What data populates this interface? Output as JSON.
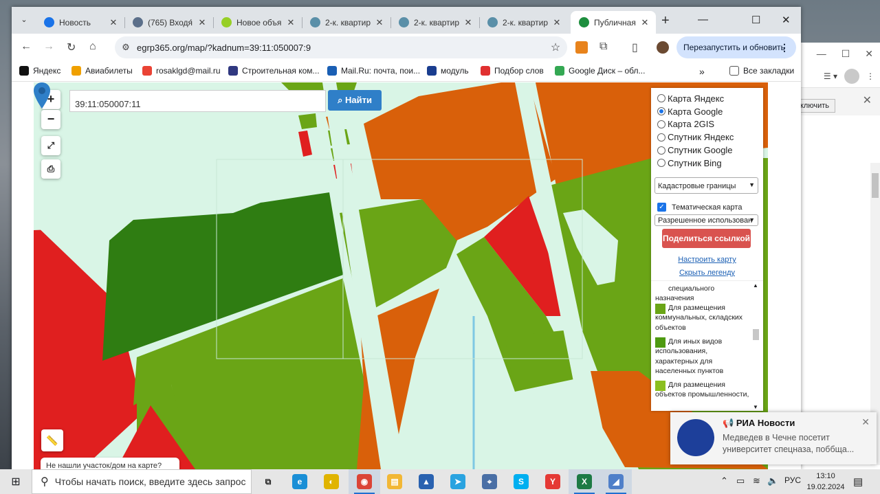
{
  "browser": {
    "tabs": [
      {
        "label": "Новость",
        "icon": "at-sign-icon",
        "color": "#1a73e8"
      },
      {
        "label": "(765) Входя́",
        "icon": "mail-icon",
        "color": "#5b6f8a"
      },
      {
        "label": "Новое объя",
        "icon": "avito-icon",
        "color": "#97cf26"
      },
      {
        "label": "2-к. квартир",
        "icon": "site-icon",
        "color": "#5a8fa8"
      },
      {
        "label": "2-к. квартир",
        "icon": "site-icon",
        "color": "#5a8fa8"
      },
      {
        "label": "2-к. квартир",
        "icon": "site-icon",
        "color": "#5a8fa8"
      },
      {
        "label": "Публичная",
        "icon": "check-icon",
        "color": "#1e8e3e",
        "active": true
      }
    ],
    "url": "egrp365.org/map/?kadnum=39:11:050007:9",
    "relaunch_label": "Перезапустить и обновить",
    "bookmarks": [
      {
        "label": "Яндекс",
        "color": "#111111"
      },
      {
        "label": "Авиабилеты",
        "color": "#f0a000"
      },
      {
        "label": "rosaklgd@mail.ru",
        "color": "#ea4335"
      },
      {
        "label": "Строительная ком...",
        "color": "#303880"
      },
      {
        "label": "Mail.Ru: почта, пои...",
        "color": "#1a5fb4"
      },
      {
        "label": "модуль",
        "color": "#1a3d8f"
      },
      {
        "label": "Подбор слов",
        "color": "#e03030"
      },
      {
        "label": "Google Диск – обл...",
        "color": "#34a853"
      }
    ],
    "all_bookmarks_label": "Все закладки"
  },
  "map": {
    "search_value": "39:11:050007:11",
    "find_label": "Найти",
    "bottom_hint": "Не нашли участок/дом на карте?"
  },
  "panel": {
    "layers": [
      {
        "label": "Карта Яндекс",
        "checked": false
      },
      {
        "label": "Карта Google",
        "checked": true
      },
      {
        "label": "Карта 2GIS",
        "checked": false
      },
      {
        "label": "Спутник Яндекс",
        "checked": false
      },
      {
        "label": "Спутник Google",
        "checked": false
      },
      {
        "label": "Спутник Bing",
        "checked": false
      }
    ],
    "boundaries_select": "Кадастровые границы",
    "thematic_label": "Тематическая карта",
    "usage_select": "Разрешенное использован",
    "share_label": "Поделиться ссылкой",
    "configure_link": "Настроить карту",
    "hide_legend_link": "Скрыть легенду",
    "legend": [
      {
        "label": "специального назначения",
        "color": ""
      },
      {
        "label": "Для размещения коммунальных, складских объектов",
        "color": "#6aa516"
      },
      {
        "label": "Для иных видов использования, характерных для населенных пунктов",
        "color": "#4e9a10"
      },
      {
        "label": "Для размещения объектов промышленности,",
        "color": "#8bbf1f"
      }
    ]
  },
  "background_window": {
    "button_label": "ключить"
  },
  "toast": {
    "source": "РИА Новости",
    "message": "Медведев в Чечне посетит университет спецназа, поббща..."
  },
  "taskbar": {
    "search_placeholder": "Чтобы начать поиск, введите здесь запрос",
    "language": "РУС",
    "time": "13:10",
    "date": "19.02.2024"
  }
}
